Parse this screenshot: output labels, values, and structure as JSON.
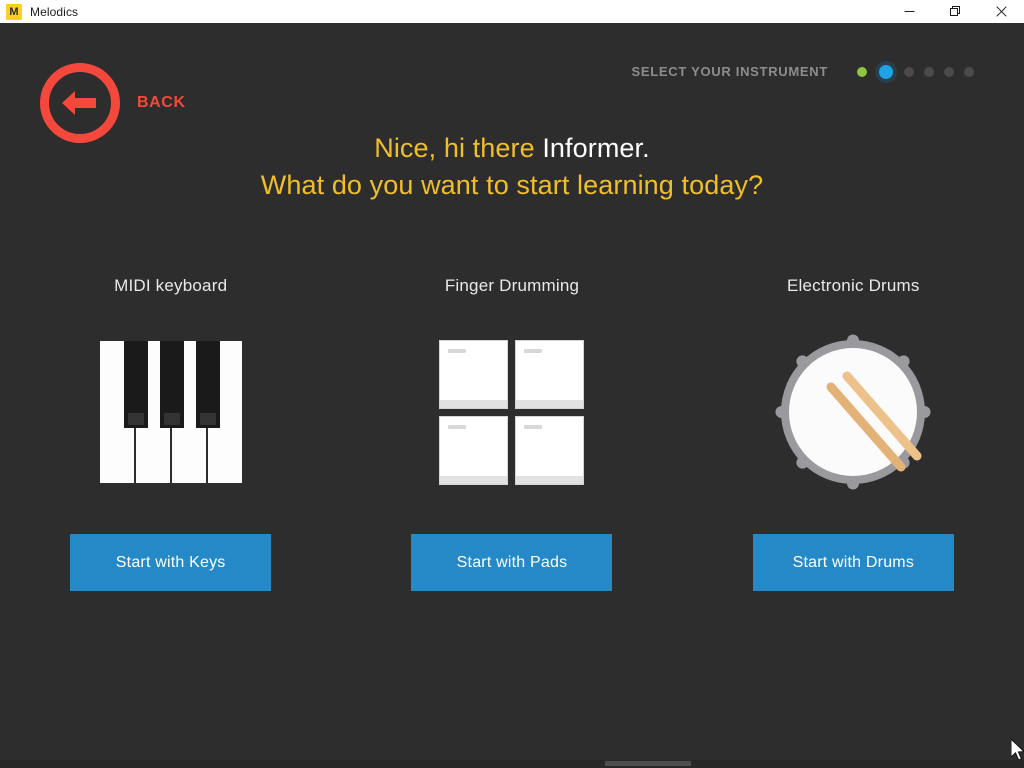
{
  "window": {
    "title": "Melodics",
    "icon_letter": "M",
    "icon_name": "melodics-app-icon",
    "controls": [
      {
        "name": "minimize-button",
        "icon": "minimize-icon"
      },
      {
        "name": "restore-button",
        "icon": "restore-icon"
      },
      {
        "name": "close-button",
        "icon": "close-icon"
      }
    ]
  },
  "nav": {
    "back_label": "BACK",
    "back_icon": "arrow-left-icon",
    "back_color": "#f4483c"
  },
  "progress": {
    "title": "SELECT YOUR INSTRUMENT",
    "steps": [
      {
        "state": "done"
      },
      {
        "state": "current"
      },
      {
        "state": "todo"
      },
      {
        "state": "todo"
      },
      {
        "state": "todo"
      },
      {
        "state": "todo"
      }
    ],
    "done_color": "#8cc63e",
    "current_color": "#1fa3e6",
    "todo_color": "#4a4a4a"
  },
  "greeting": {
    "line1_prefix": "Nice, hi there ",
    "line1_name": "Informer.",
    "line2": "What do you want to start learning today?",
    "highlight_color": "#f0bf28",
    "name_color": "#ffffff"
  },
  "options": [
    {
      "title": "MIDI keyboard",
      "art": "piano-illustration",
      "button_label": "Start with Keys",
      "button_name": "start-with-keys-button"
    },
    {
      "title": "Finger Drumming",
      "art": "drum-pads-illustration",
      "button_label": "Start with Pads",
      "button_name": "start-with-pads-button"
    },
    {
      "title": "Electronic Drums",
      "art": "drum-kit-illustration",
      "button_label": "Start with Drums",
      "button_name": "start-with-drums-button"
    }
  ],
  "theme": {
    "background": "#2d2d2d",
    "button_blue": "#2489c6"
  }
}
